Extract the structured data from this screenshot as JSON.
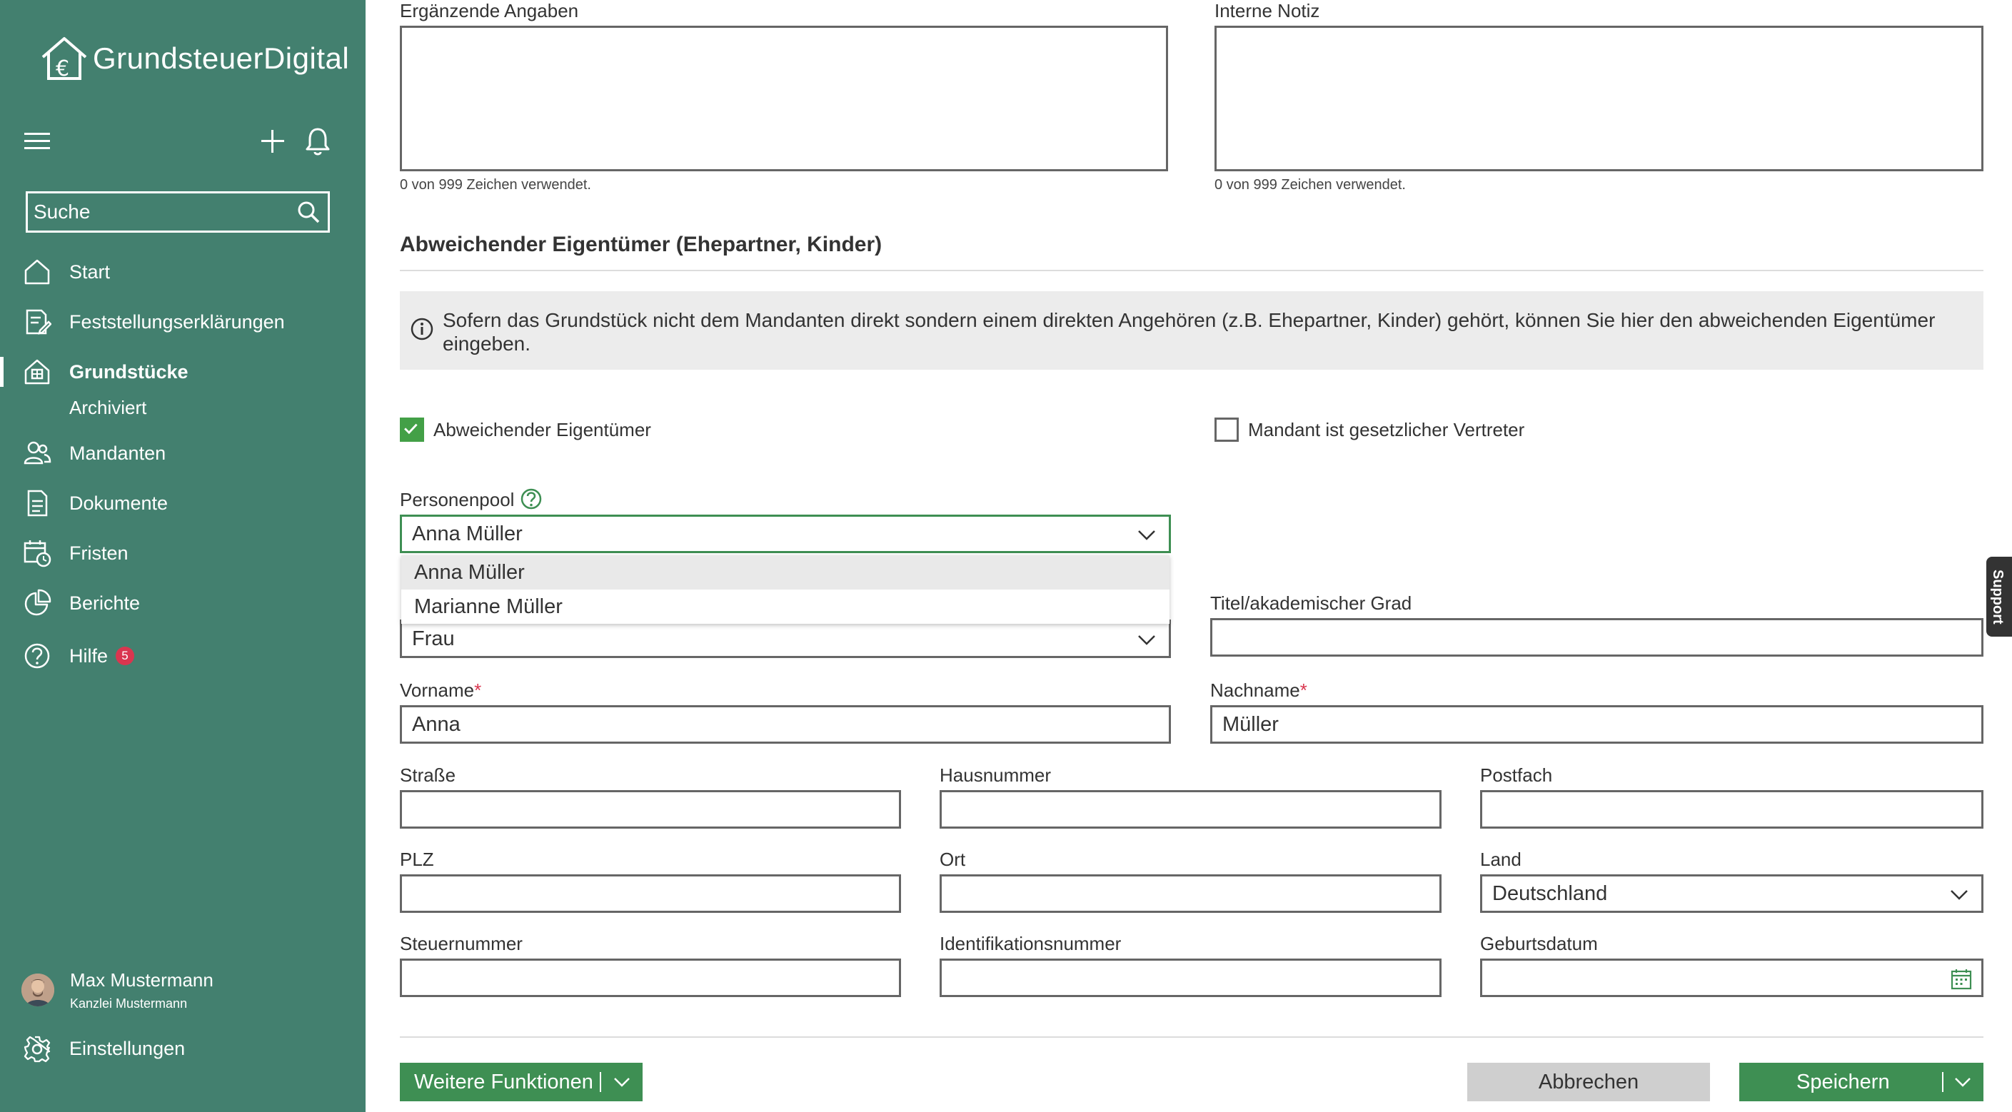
{
  "sidebar": {
    "logo_text": "GrundsteuerDigital",
    "search_placeholder": "Suche",
    "nav": {
      "start": "Start",
      "feststellungserklaerungen": "Feststellungserklärungen",
      "grundstuecke": "Grundstücke",
      "archiviert": "Archiviert",
      "mandanten": "Mandanten",
      "dokumente": "Dokumente",
      "fristen": "Fristen",
      "berichte": "Berichte",
      "hilfe": "Hilfe",
      "hilfe_badge": "5"
    },
    "user": {
      "name": "Max Mustermann",
      "firm": "Kanzlei Mustermann"
    },
    "settings": "Einstellungen",
    "brand_color": "#43806f"
  },
  "form": {
    "ergaenzende_label": "Ergänzende Angaben",
    "ergaenzende_counter": "0 von 999 Zeichen verwendet.",
    "interne_label": "Interne Notiz",
    "interne_counter": "0 von 999 Zeichen verwendet.",
    "section_title": "Abweichender Eigentümer (Ehepartner, Kinder)",
    "info_text": "Sofern das Grundstück nicht dem Mandanten direkt sondern einem direkten Angehören (z.B. Ehepartner, Kinder) gehört, können Sie hier den abweichenden Eigentümer eingeben.",
    "checkbox_abweichender": {
      "label": "Abweichender Eigentümer",
      "checked": true
    },
    "checkbox_vertreter": {
      "label": "Mandant ist gesetzlicher Vertreter",
      "checked": false
    },
    "personenpool": {
      "label": "Personenpool",
      "value": "Anna Müller",
      "options": [
        "Anna Müller",
        "Marianne Müller"
      ]
    },
    "anrede_value": "Frau",
    "titel_label": "Titel/akademischer Grad",
    "vorname_label": "Vorname",
    "vorname_value": "Anna",
    "nachname_label": "Nachname",
    "nachname_value": "Müller",
    "required_mark": "*",
    "strasse_label": "Straße",
    "hausnummer_label": "Hausnummer",
    "postfach_label": "Postfach",
    "plz_label": "PLZ",
    "ort_label": "Ort",
    "land_label": "Land",
    "land_value": "Deutschland",
    "steuernummer_label": "Steuernummer",
    "identifikationsnummer_label": "Identifikationsnummer",
    "geburtsdatum_label": "Geburtsdatum"
  },
  "footer": {
    "weitere_funktionen": "Weitere Funktionen",
    "abbrechen": "Abbrechen",
    "speichern": "Speichern"
  },
  "support_tab": "Support"
}
